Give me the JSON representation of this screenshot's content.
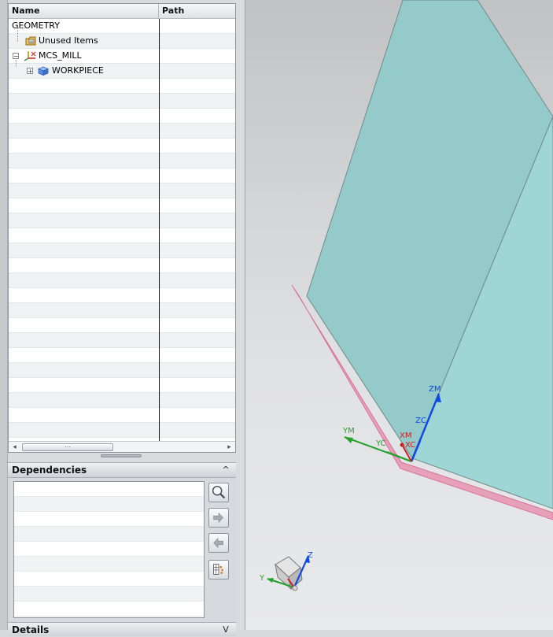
{
  "navigator": {
    "columns": {
      "name": "Name",
      "path": "Path"
    },
    "items": [
      {
        "label": "GEOMETRY",
        "icon": "geometry-root"
      },
      {
        "label": "Unused Items",
        "icon": "folder-icon"
      },
      {
        "label": "MCS_MILL",
        "icon": "mcs-coordinate-icon"
      },
      {
        "label": "WORKPIECE",
        "icon": "workpiece-cube-icon"
      }
    ],
    "scrollbar": {
      "left": "◂",
      "right": "▸",
      "grip": "⋯"
    }
  },
  "dependencies": {
    "title": "Dependencies",
    "collapse": "^"
  },
  "details": {
    "title": "Details",
    "collapse": "V"
  },
  "viewport": {
    "axis_labels": {
      "zm": "ZM",
      "zc": "ZC",
      "ym": "YM",
      "yc": "YC",
      "xm": "XM",
      "xc": "XC"
    },
    "triad_labels": {
      "z": "Z",
      "y": "Y"
    },
    "colors": {
      "part_face": "#99d0cf",
      "part_edge": "#dc8ca9",
      "x_axis": "#cc2222",
      "y_axis": "#24a12a",
      "z_axis": "#1149e6"
    }
  }
}
